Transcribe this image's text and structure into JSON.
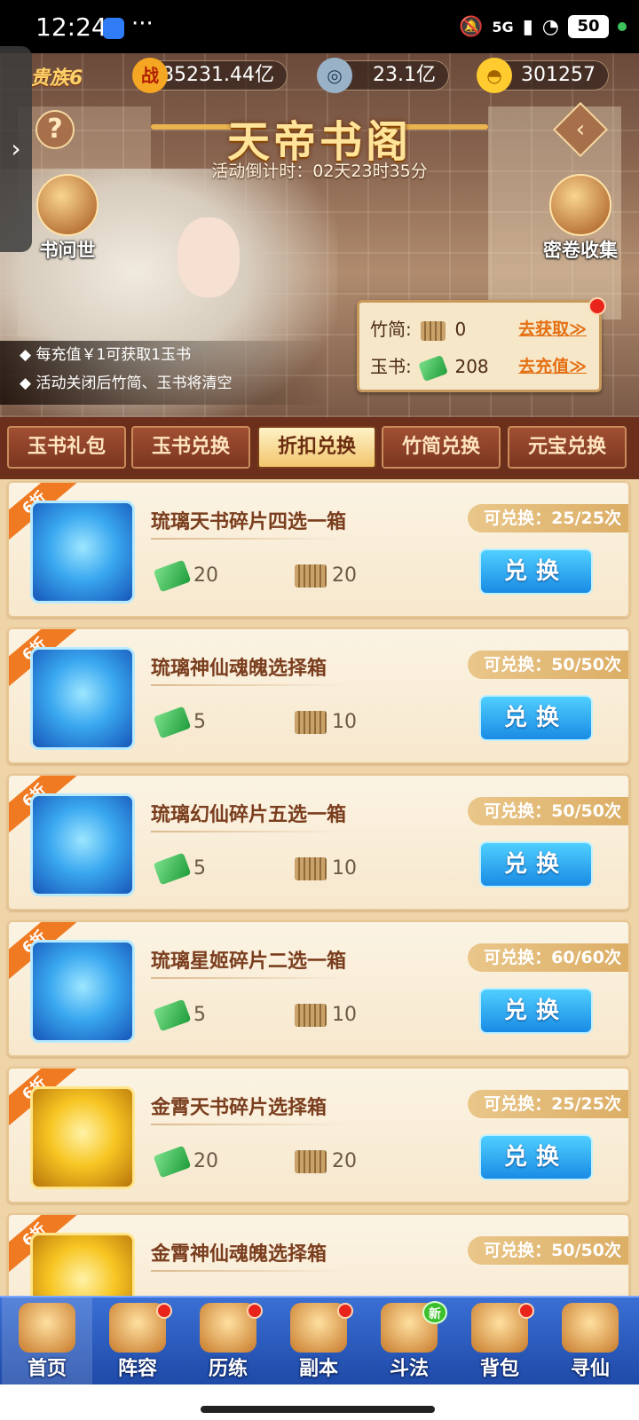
{
  "status_bar": {
    "time": "12:24",
    "more": "···",
    "signal": "5G",
    "battery": "50"
  },
  "top_bar": {
    "vip": "贵族6",
    "power_icon": "战",
    "power": "185231.44亿",
    "coin": "23.1亿",
    "gold": "301257"
  },
  "header": {
    "help": "?",
    "title": "天帝书阁",
    "countdown": "活动倒计时：02天23时35分",
    "left_entry": "书问世",
    "right_entry": "密卷收集"
  },
  "resources": {
    "bamboo_label": "竹简:",
    "bamboo_value": "0",
    "bamboo_link": "去获取≫",
    "jade_label": "玉书:",
    "jade_value": "208",
    "jade_link": "去充值≫"
  },
  "notes": [
    "每充值￥1可获取1玉书",
    "活动关闭后竹简、玉书将清空"
  ],
  "tabs": [
    {
      "label": "玉书礼包"
    },
    {
      "label": "玉书兑换"
    },
    {
      "label": "折扣兑换",
      "active": true
    },
    {
      "label": "竹简兑换"
    },
    {
      "label": "元宝兑换"
    }
  ],
  "items": [
    {
      "discount": "6折",
      "name": "琉璃天书碎片四选一箱",
      "limit": "可兑换：25/25次",
      "jade": "20",
      "bamboo": "20",
      "button": "兑换",
      "theme": "blue"
    },
    {
      "discount": "6折",
      "name": "琉璃神仙魂魄选择箱",
      "limit": "可兑换：50/50次",
      "jade": "5",
      "bamboo": "10",
      "button": "兑换",
      "theme": "blue"
    },
    {
      "discount": "6折",
      "name": "琉璃幻仙碎片五选一箱",
      "limit": "可兑换：50/50次",
      "jade": "5",
      "bamboo": "10",
      "button": "兑换",
      "theme": "blue"
    },
    {
      "discount": "6折",
      "name": "琉璃星姬碎片二选一箱",
      "limit": "可兑换：60/60次",
      "jade": "5",
      "bamboo": "10",
      "button": "兑换",
      "theme": "blue"
    },
    {
      "discount": "6折",
      "name": "金霄天书碎片选择箱",
      "limit": "可兑换：25/25次",
      "jade": "20",
      "bamboo": "20",
      "button": "兑换",
      "theme": "gold"
    },
    {
      "discount": "6折",
      "name": "金霄神仙魂魄选择箱",
      "limit": "可兑换：50/50次",
      "theme": "gold"
    }
  ],
  "bottom_nav": [
    {
      "label": "首页",
      "active": true
    },
    {
      "label": "阵容",
      "dot": true
    },
    {
      "label": "历练",
      "dot": true
    },
    {
      "label": "副本",
      "dot": true
    },
    {
      "label": "斗法",
      "badge": "新"
    },
    {
      "label": "背包",
      "dot": true
    },
    {
      "label": "寻仙"
    }
  ]
}
